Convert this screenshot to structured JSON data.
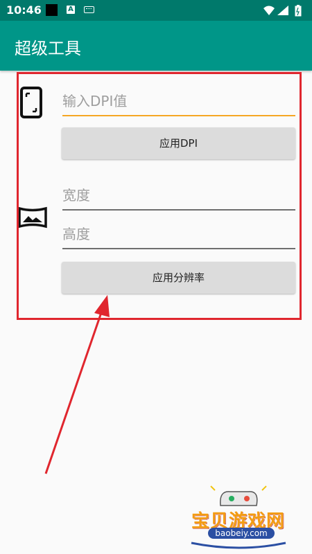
{
  "status_bar": {
    "time": "10:46",
    "icons": [
      "notification-square-icon",
      "a-letter-icon",
      "keyboard-icon",
      "wifi-icon",
      "signal-icon",
      "battery-icon"
    ]
  },
  "app_bar": {
    "title": "超级工具"
  },
  "dpi": {
    "icon": "phone-frame-icon",
    "input_placeholder": "输入DPI值",
    "button_label": "应用DPI"
  },
  "resolution": {
    "icon": "panorama-icon",
    "width_placeholder": "宽度",
    "height_placeholder": "高度",
    "button_label": "应用分辨率"
  },
  "annotation": {
    "color": "#e0262e"
  },
  "watermark": {
    "title": "宝贝游戏网",
    "domain": "baobeiy.com"
  },
  "colors": {
    "primary": "#009688",
    "primary_dark": "#00796b",
    "accent": "#f5a623"
  }
}
